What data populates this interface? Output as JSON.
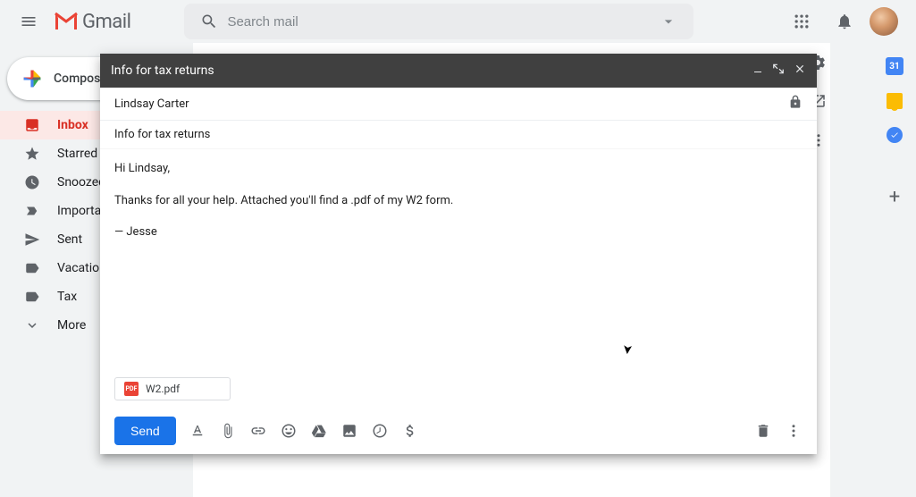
{
  "header": {
    "logo_text": "Gmail",
    "search_placeholder": "Search mail"
  },
  "sidebar": {
    "compose_label": "Compose",
    "items": [
      {
        "label": "Inbox"
      },
      {
        "label": "Starred"
      },
      {
        "label": "Snoozed"
      },
      {
        "label": "Important"
      },
      {
        "label": "Sent"
      },
      {
        "label": "Vacation"
      },
      {
        "label": "Tax"
      },
      {
        "label": "More"
      }
    ]
  },
  "rail": {
    "calendar_day": "31"
  },
  "compose": {
    "title": "Info for tax returns",
    "to": "Lindsay Carter",
    "subject": "Info for tax returns",
    "body_line1": "Hi Lindsay,",
    "body_line2": "Thanks for all your help. Attached you'll find a .pdf of my W2 form.",
    "body_line3": "— Jesse",
    "attachment": {
      "name": "W2.pdf",
      "badge": "PDF"
    },
    "send_label": "Send"
  }
}
